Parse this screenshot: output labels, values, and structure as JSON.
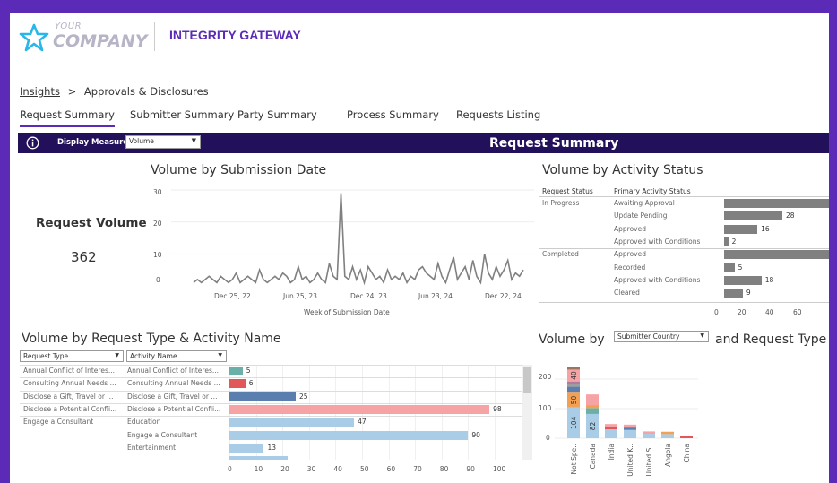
{
  "header": {
    "logo_top": "YOUR",
    "logo_bottom": "COMPANY",
    "app_name": "INTEGRITY GATEWAY"
  },
  "breadcrumb": {
    "link": "Insights",
    "separator": ">",
    "current": "Approvals & Disclosures"
  },
  "tabs": [
    {
      "label": "Request Summary",
      "active": true
    },
    {
      "label": "Submitter Summary",
      "active": false
    },
    {
      "label": "Party Summary",
      "active": false
    },
    {
      "label": "Process Summary",
      "active": false
    },
    {
      "label": "Requests Listing",
      "active": false
    }
  ],
  "toolbar": {
    "info_icon": "info-icon",
    "measure_label": "Display Measure:",
    "measure_value": "Volume",
    "title": "Request Summary"
  },
  "kpi": {
    "label": "Request Volume",
    "value": "362"
  },
  "colors": {
    "brand": "#5b2bb8",
    "toolbar": "#23105a",
    "line": "#808080",
    "bar_gray": "#808080"
  },
  "line_chart": {
    "title": "Volume by Submission Date",
    "xlabel": "Week of Submission Date",
    "y_ticks": [
      "30",
      "20",
      "10",
      "0"
    ],
    "x_ticks": [
      "Dec 25, 22",
      "Jun 25, 23",
      "Dec 24, 23",
      "Jun 23, 24",
      "Dec 22, 24"
    ]
  },
  "status_chart": {
    "title": "Volume by Activity Status",
    "col1": "Request Status",
    "col2": "Primary Activity Status",
    "x_ticks": [
      "0",
      "20",
      "40",
      "60"
    ]
  },
  "type_chart": {
    "title": "Volume by Request Type & Activity Name",
    "filter1": "Request Type",
    "filter2": "Activity Name",
    "x_ticks": [
      "0",
      "10",
      "20",
      "30",
      "40",
      "50",
      "60",
      "70",
      "80",
      "90",
      "100"
    ]
  },
  "country_chart": {
    "title_left": "Volume by",
    "dropdown": "Submitter Country",
    "title_right": "and Request Type",
    "y_ticks": [
      "200",
      "100",
      "0"
    ]
  },
  "chart_data": [
    {
      "type": "line",
      "title": "Volume by Submission Date",
      "xlabel": "Week of Submission Date",
      "ylabel": "",
      "ylim": [
        0,
        30
      ],
      "x_range": [
        "Sep 2022",
        "Feb 2025"
      ],
      "series": [
        {
          "values": [
            1,
            2,
            1,
            2,
            3,
            2,
            1,
            3,
            2,
            1,
            2,
            4,
            1,
            2,
            3,
            2,
            1,
            5,
            2,
            1,
            2,
            3,
            2,
            4,
            3,
            1,
            2,
            6,
            2,
            3,
            1,
            2,
            4,
            2,
            1,
            7,
            3,
            2,
            29,
            3,
            2,
            6,
            2,
            5,
            1,
            6,
            4,
            2,
            3,
            1,
            5,
            2,
            3,
            2,
            4,
            1,
            3,
            2,
            5,
            6,
            4,
            3,
            2,
            7,
            3,
            1,
            5,
            9,
            2,
            4,
            6,
            2,
            8,
            3,
            1,
            10,
            4,
            2,
            6,
            3,
            5,
            8,
            2,
            4,
            3,
            5
          ]
        }
      ]
    },
    {
      "type": "bar",
      "title": "Volume by Activity Status",
      "orientation": "horizontal",
      "xlim": [
        0,
        70
      ],
      "rows": [
        {
          "status": "In Progress",
          "activity": "Awaiting Approval",
          "value": 70,
          "label": ""
        },
        {
          "status": "",
          "activity": "Update Pending",
          "value": 28,
          "label": "28"
        },
        {
          "status": "",
          "activity": "Approved",
          "value": 16,
          "label": "16"
        },
        {
          "status": "",
          "activity": "Approved with Conditions",
          "value": 2,
          "label": "2"
        },
        {
          "status": "Completed",
          "activity": "Approved",
          "value": 64,
          "label": "64"
        },
        {
          "status": "",
          "activity": "Recorded",
          "value": 5,
          "label": "5"
        },
        {
          "status": "",
          "activity": "Approved with Conditions",
          "value": 18,
          "label": "18"
        },
        {
          "status": "",
          "activity": "Cleared",
          "value": 9,
          "label": "9"
        }
      ]
    },
    {
      "type": "bar",
      "title": "Volume by Request Type & Activity Name",
      "orientation": "horizontal",
      "xlim": [
        0,
        105
      ],
      "rows": [
        {
          "type": "Annual Conflict of Interes...",
          "activity": "Annual Conflict of Interes...",
          "value": 5,
          "label": "5",
          "color": "#6ab0a8"
        },
        {
          "type": "Consulting Annual Needs ...",
          "activity": "Consulting Annual Needs ...",
          "value": 6,
          "label": "6",
          "color": "#e2585a"
        },
        {
          "type": "Disclose a Gift, Travel or ...",
          "activity": "Disclose a Gift, Travel or ...",
          "value": 25,
          "label": "25",
          "color": "#5a7fae"
        },
        {
          "type": "Disclose a Potential Confli...",
          "activity": "Disclose a Potential Confli...",
          "value": 98,
          "label": "98",
          "color": "#f6a3a5"
        },
        {
          "type": "Engage a Consultant",
          "activity": "Education",
          "value": 47,
          "label": "47",
          "color": "#a9cde6"
        },
        {
          "type": "",
          "activity": "Engage a Consultant",
          "value": 90,
          "label": "90",
          "color": "#a9cde6"
        },
        {
          "type": "",
          "activity": "Entertainment",
          "value": 13,
          "label": "13",
          "color": "#a9cde6"
        },
        {
          "type": "",
          "activity": "",
          "value": 22,
          "label": "",
          "color": "#a9cde6"
        }
      ]
    },
    {
      "type": "bar",
      "title": "Volume by Submitter Country and Request Type",
      "stacked": true,
      "ylim": [
        0,
        260
      ],
      "categories": [
        "Not Spe..",
        "Canada",
        "India",
        "United K..",
        "United S..",
        "Angola",
        "China"
      ],
      "stacks": [
        [
          {
            "value": 104,
            "label": "104",
            "color": "#a9cde6"
          },
          {
            "value": 50,
            "label": "50",
            "color": "#f2a154"
          },
          {
            "value": 20,
            "label": "",
            "color": "#5a7fae"
          },
          {
            "value": 10,
            "label": "",
            "color": "#9e9e9e"
          },
          {
            "value": 8,
            "label": "",
            "color": "#b07aa1"
          },
          {
            "value": 40,
            "label": "40",
            "color": "#f6a3a5"
          },
          {
            "value": 8,
            "label": "",
            "color": "#9d7660"
          }
        ],
        [
          {
            "value": 82,
            "label": "82",
            "color": "#a9cde6"
          },
          {
            "value": 20,
            "label": "",
            "color": "#6ab0a8"
          },
          {
            "value": 10,
            "label": "",
            "color": "#f2a154"
          },
          {
            "value": 36,
            "label": "",
            "color": "#f6a3a5"
          }
        ],
        [
          {
            "value": 30,
            "label": "",
            "color": "#a9cde6"
          },
          {
            "value": 8,
            "label": "",
            "color": "#e2585a"
          },
          {
            "value": 10,
            "label": "",
            "color": "#f6a3a5"
          }
        ],
        [
          {
            "value": 28,
            "label": "",
            "color": "#a9cde6"
          },
          {
            "value": 8,
            "label": "",
            "color": "#5a7fae"
          },
          {
            "value": 10,
            "label": "",
            "color": "#f6a3a5"
          }
        ],
        [
          {
            "value": 15,
            "label": "",
            "color": "#a9cde6"
          },
          {
            "value": 8,
            "label": "",
            "color": "#f6a3a5"
          }
        ],
        [
          {
            "value": 14,
            "label": "",
            "color": "#a9cde6"
          },
          {
            "value": 8,
            "label": "",
            "color": "#f2a154"
          }
        ],
        [
          {
            "value": 8,
            "label": "",
            "color": "#e2585a"
          }
        ]
      ]
    }
  ]
}
